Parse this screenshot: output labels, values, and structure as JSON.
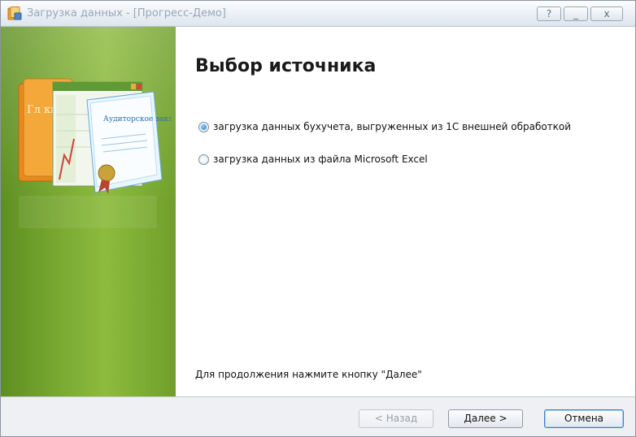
{
  "window": {
    "title": "Загрузка данных - [Прогресс-Демо]",
    "icon": "app-icon",
    "buttons": {
      "help": "?",
      "minimize": "_",
      "close": "x"
    }
  },
  "sidebar": {
    "art_icon": "audit-report-illustration",
    "art_text": {
      "book": "Гл кн",
      "certificate": "Аудиторское заключение"
    }
  },
  "main": {
    "heading": "Выбор источника",
    "options": [
      {
        "label": "загрузка данных бухучета, выгруженных из 1С внешней обработкой",
        "selected": true
      },
      {
        "label": "загрузка данных из файла Microsoft Excel",
        "selected": false
      }
    ],
    "hint": "Для продолжения нажмите кнопку \"Далее\""
  },
  "footer": {
    "back": "< Назад",
    "next": "Далее >",
    "cancel": "Отмена"
  },
  "colors": {
    "sidebar": "#7aaa32",
    "title_text": "#9aa7b8",
    "default_border": "#3c7fd0"
  }
}
